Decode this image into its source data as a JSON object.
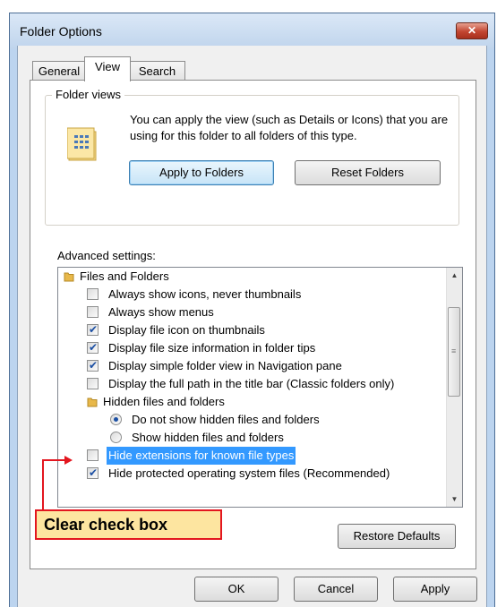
{
  "window": {
    "title": "Folder Options",
    "close_label": "✕"
  },
  "tabs": [
    {
      "label": "General"
    },
    {
      "label": "View"
    },
    {
      "label": "Search"
    }
  ],
  "folder_views": {
    "legend": "Folder views",
    "description": "You can apply the view (such as Details or Icons) that you are using for this folder to all folders of this type.",
    "apply_button": "Apply to Folders",
    "reset_button": "Reset Folders"
  },
  "advanced": {
    "label": "Advanced settings:",
    "items": [
      {
        "type": "folder",
        "label": "Files and Folders"
      },
      {
        "type": "checkbox",
        "checked": false,
        "label": "Always show icons, never thumbnails"
      },
      {
        "type": "checkbox",
        "checked": false,
        "label": "Always show menus"
      },
      {
        "type": "checkbox",
        "checked": true,
        "label": "Display file icon on thumbnails"
      },
      {
        "type": "checkbox",
        "checked": true,
        "label": "Display file size information in folder tips"
      },
      {
        "type": "checkbox",
        "checked": true,
        "label": "Display simple folder view in Navigation pane"
      },
      {
        "type": "checkbox",
        "checked": false,
        "label": "Display the full path in the title bar (Classic folders only)"
      },
      {
        "type": "folder",
        "label": "Hidden files and folders"
      },
      {
        "type": "radio",
        "checked": true,
        "label": "Do not show hidden files and folders"
      },
      {
        "type": "radio",
        "checked": false,
        "label": "Show hidden files and folders"
      },
      {
        "type": "checkbox",
        "checked": false,
        "selected": true,
        "label": "Hide extensions for known file types"
      },
      {
        "type": "checkbox",
        "checked": true,
        "label": "Hide protected operating system files (Recommended)"
      }
    ]
  },
  "restore_button": "Restore Defaults",
  "footer": {
    "ok": "OK",
    "cancel": "Cancel",
    "apply": "Apply"
  },
  "callout": {
    "text": "Clear check box",
    "color": "#e3161f",
    "fill": "#fde5a0"
  },
  "colors": {
    "selection": "#3399ff",
    "check": "#1b4fa3",
    "titlebar": "#bfd4ec"
  }
}
